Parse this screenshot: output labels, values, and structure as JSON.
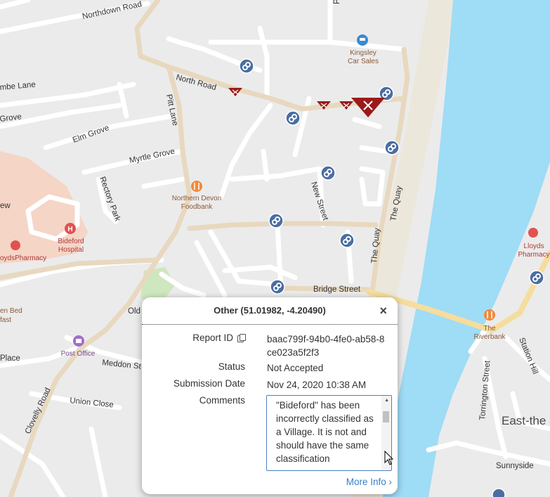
{
  "map": {
    "road_labels": {
      "northdown": "Northdown Road",
      "north": "North Road",
      "combe": "mbe Lane",
      "grove": "Grove",
      "elm": "Elm Grove",
      "myrtle": "Myrtle Grove",
      "pitt": "Pitt Lane",
      "rectory": "Rectory Park",
      "new_street": "New Street",
      "the_quay_a": "The Quay",
      "the_quay_b": "The Quay",
      "bridge": "Bridge Street",
      "old": "Old",
      "meddon": "Meddon St",
      "place": "Place",
      "union": "Union Close",
      "clovelly": "Clovelly Road",
      "torrington": "Torrington Street",
      "station_hill": "Station Hill",
      "sunnyside": "Sunnyside",
      "ew": "ew",
      "east": "East-the",
      "p": "P"
    },
    "poi_labels": {
      "kingsley": [
        "Kingsley",
        "Car Sales"
      ],
      "foodbank": [
        "Northern Devon",
        "Foodbank"
      ],
      "hospital": [
        "Bideford",
        "Hospital"
      ],
      "pharmacy_w": "oydsPharmacy",
      "pharmacy_e": [
        "Lloyds",
        "Pharmacy"
      ],
      "post_office": "Post Office",
      "riverbank": [
        "The",
        "Riverbank"
      ],
      "bed": [
        "en Bed",
        "fast"
      ]
    },
    "colors": {
      "land": "#ebebeb",
      "road": "#ffffff",
      "major_road": "#e8d8bf",
      "primary_road": "#f5dd9e",
      "water": "#9fdcf6",
      "shore": "#ece7db",
      "hospital_area": "#f4d5c6",
      "park": "#cfe7bf",
      "marker_blue": "#4a6ea3",
      "marker_red": "#9b1a1a",
      "accent_link": "#3a7fc4"
    },
    "icons": {
      "report_marker": "blue-wrench-marker-icon",
      "issue_marker": "red-triangle-x-marker-icon",
      "poi_car": "car-icon",
      "poi_food": "fork-knife-icon",
      "poi_hospital": "hospital-h-icon",
      "poi_pharmacy": "pharmacy-icon",
      "poi_post": "post-office-icon"
    }
  },
  "popup": {
    "title": "Other (51.01982, -4.20490)",
    "close_label": "×",
    "fields": {
      "report_id_label": "Report ID",
      "report_id_value": "baac799f-94b0-4fe0-ab58-8ce023a5f2f3",
      "status_label": "Status",
      "status_value": "Not Accepted",
      "submission_label": "Submission Date",
      "submission_value": "Nov 24, 2020 10:38 AM",
      "comments_label": "Comments",
      "comments_value": "\"Bideford\" has been incorrectly classified as a Village. It is not and should have the same classification"
    },
    "more_info": "More Info ›"
  }
}
